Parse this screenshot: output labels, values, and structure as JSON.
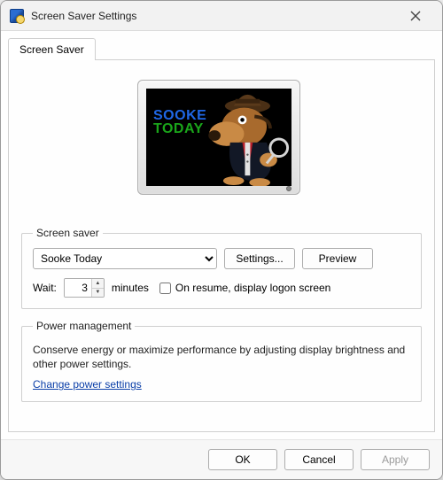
{
  "window": {
    "title": "Screen Saver Settings",
    "close_icon": "close-icon"
  },
  "tabs": {
    "screen_saver": "Screen Saver"
  },
  "preview": {
    "logo_line1": "SOOKE",
    "logo_line2": "TODAY"
  },
  "screensaver_section": {
    "legend": "Screen saver",
    "selected": "Sooke Today",
    "settings_btn": "Settings...",
    "preview_btn": "Preview",
    "wait_label": "Wait:",
    "wait_value": "3",
    "minutes_label": "minutes",
    "on_resume_label": "On resume, display logon screen",
    "on_resume_checked": false
  },
  "power_section": {
    "legend": "Power management",
    "text": "Conserve energy or maximize performance by adjusting display brightness and other power settings.",
    "link": "Change power settings"
  },
  "footer": {
    "ok": "OK",
    "cancel": "Cancel",
    "apply": "Apply"
  }
}
